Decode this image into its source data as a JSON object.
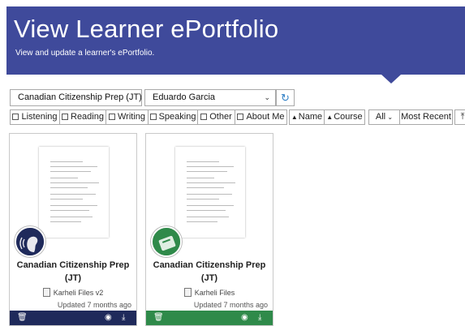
{
  "header": {
    "title": "View Learner ePortfolio",
    "subtitle": "View and update a learner's ePortfolio."
  },
  "filters": {
    "course_select": "Canadian Citizenship Prep (JT)",
    "learner_select": "Eduardo Garcia",
    "categories": [
      "Listening",
      "Reading",
      "Writing",
      "Speaking",
      "Other",
      "About Me"
    ],
    "sort_name": "Name",
    "sort_course": "Course",
    "all_filter": "All",
    "sort_recent": "Most Recent"
  },
  "cards": [
    {
      "title": "Canadian Citizenship Prep (JT)",
      "source": "Karheli Files v2",
      "updated": "Updated 7 months ago",
      "accent": "#1f2a5b"
    },
    {
      "title": "Canadian Citizenship Prep (JT)",
      "source": "Karheli Files",
      "updated": "Updated 7 months ago",
      "accent": "#2f8a4a"
    }
  ],
  "colors": {
    "banner": "#3f4a9b",
    "refresh_icon": "#2f7fc5"
  }
}
